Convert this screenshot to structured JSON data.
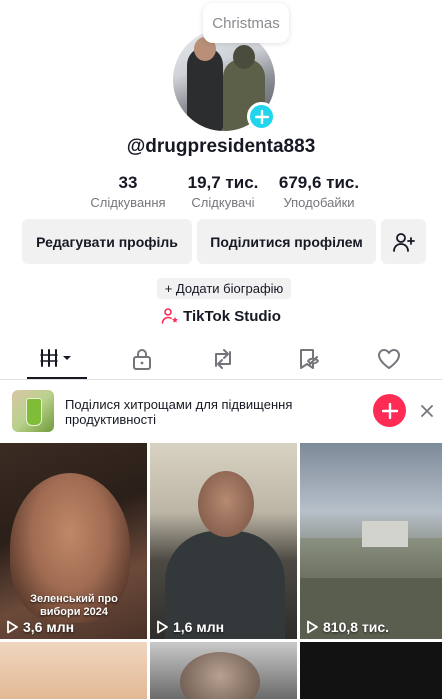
{
  "profile": {
    "status_bubble": "Christmas",
    "username": "@drugpresidenta883",
    "stats": [
      {
        "value": "33",
        "label": "Слідкування"
      },
      {
        "value": "19,7 тис.",
        "label": "Слідкувачі"
      },
      {
        "value": "679,6 тис.",
        "label": "Уподобайки"
      }
    ],
    "edit_button": "Редагувати профіль",
    "share_button": "Поділитися профілем",
    "add_bio": "+ Додати біографію",
    "studio_label": "TikTok Studio"
  },
  "tabs": [
    "videos-grid",
    "private-lock",
    "reposts",
    "favorites",
    "liked"
  ],
  "promo": {
    "text": "Поділися хитрощами для підвищення продуктивності"
  },
  "videos": [
    {
      "caption": "Зеленський про вибори 2024",
      "views": "3,6 млн"
    },
    {
      "views": "1,6 млн"
    },
    {
      "views": "810,8 тис."
    },
    {},
    {},
    {}
  ],
  "colors": {
    "accent_cyan": "#20d5ec",
    "accent_red": "#fe2c55",
    "text_primary": "#161823",
    "button_bg": "#f1f1f2"
  }
}
